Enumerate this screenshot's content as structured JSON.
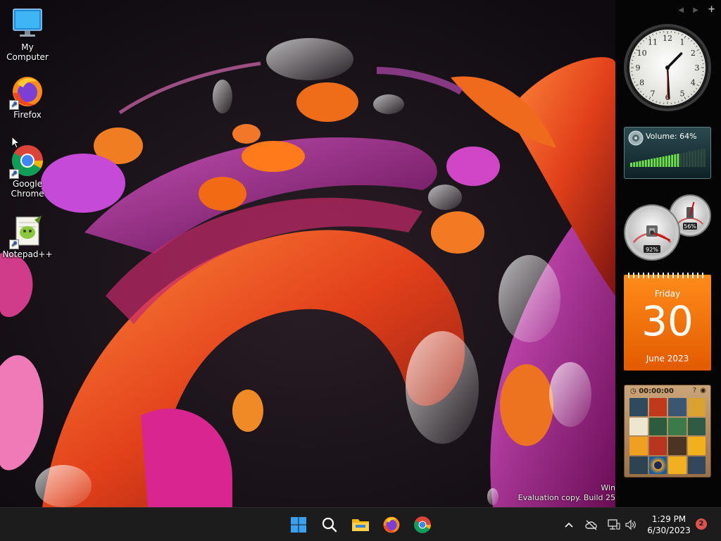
{
  "desktop": {
    "icons": [
      {
        "label": "My Computer",
        "icon": "monitor-icon"
      },
      {
        "label": "Firefox",
        "icon": "firefox-icon"
      },
      {
        "label": "Google Chrome",
        "icon": "chrome-icon"
      },
      {
        "label": "Notepad++",
        "icon": "notepadpp-icon"
      }
    ]
  },
  "watermark": {
    "line1": "Win",
    "line2": "Evaluation copy. Build 25"
  },
  "sidebar": {
    "controls": {
      "prev": "◀",
      "next": "▶",
      "add": "+"
    },
    "clock": {
      "hour": 1,
      "minute": 29,
      "second": 30
    },
    "volume": {
      "label": "Volume: 64%",
      "level": 64
    },
    "meters": {
      "cpu_label": "92%",
      "mem_label": "56%",
      "cpu": 92,
      "mem": 56
    },
    "calendar": {
      "weekday": "Friday",
      "day": "30",
      "month_year": "June 2023"
    },
    "puzzle": {
      "timer": "00:00:00"
    }
  },
  "taskbar": {
    "apps": [
      "start-icon",
      "search-icon",
      "file-explorer-icon",
      "firefox-icon",
      "chrome-icon"
    ],
    "time": "1:29 PM",
    "date": "6/30/2023",
    "notifications": "2"
  },
  "colors": {
    "accent": "#ff7a00",
    "taskbar": "#1c1c1c",
    "wallpaper_orange": "#e8541a",
    "wallpaper_magenta": "#b4208a"
  }
}
